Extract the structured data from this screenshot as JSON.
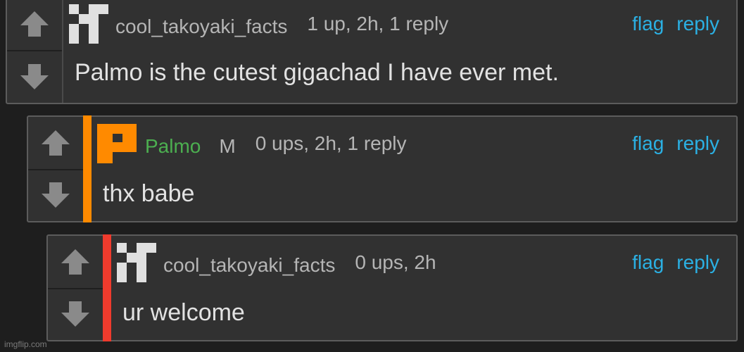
{
  "comments": [
    {
      "username": "cool_takoyaki_facts",
      "badge": "",
      "meta": "1 up, 2h, 1 reply",
      "flag_label": "flag",
      "reply_label": "reply",
      "text": "Palmo is the cutest gigachad I have ever met.",
      "avatar_icon": "pixel-avatar-icon"
    },
    {
      "username": "Palmo",
      "badge": "M",
      "meta": "0 ups, 2h, 1 reply",
      "flag_label": "flag",
      "reply_label": "reply",
      "text": "thx babe",
      "avatar_icon": "orange-p-avatar-icon",
      "thread_color": "#ff8a00",
      "username_color": "#4caf50"
    },
    {
      "username": "cool_takoyaki_facts",
      "badge": "",
      "meta": "0 ups, 2h",
      "flag_label": "flag",
      "reply_label": "reply",
      "text": "ur welcome",
      "avatar_icon": "pixel-avatar-icon",
      "thread_color": "#ef3b2d"
    }
  ],
  "watermark": "imgflip.com",
  "colors": {
    "link": "#2bb0e3",
    "text": "#e2e2e2",
    "meta": "#b5b5b5"
  }
}
